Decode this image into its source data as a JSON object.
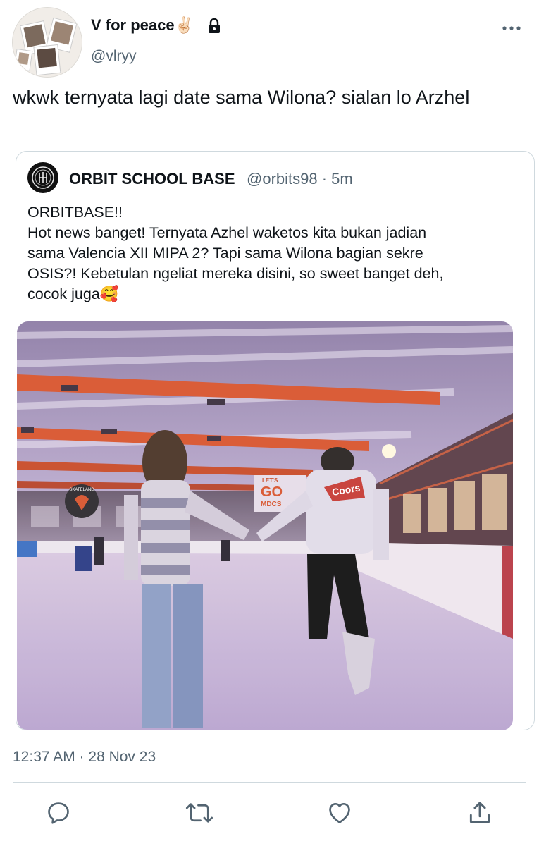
{
  "author": {
    "display_name": "V for peace✌🏻",
    "handle": "@vlryy"
  },
  "tweet": {
    "text": "wkwk ternyata lagi date sama Wilona? sialan lo Arzhel",
    "timestamp": "12:37 AM · 28 Nov 23"
  },
  "quote": {
    "display_name": "ORBIT SCHOOL BASE",
    "handle_time": "@orbits98 · 5m",
    "lines": [
      "ORBITBASE!!",
      "Hot news banget! Ternyata Azhel waketos kita bukan jadian",
      "sama Valencia XII MIPA 2? Tapi sama Wilona bagian sekre",
      "OSIS?! Kebetulan ngeliat mereka disini, so sweet banget deh,",
      "cocok juga🥰"
    ],
    "photo_signs": {
      "rink_sign_top": "LET'S",
      "rink_sign_main": "GO",
      "rink_sign_sub": "MDCS",
      "round_sign": "SKATELAND",
      "hoodie_logo": "Coors"
    }
  },
  "icons": {
    "lock": "lock-icon",
    "more": "more-icon",
    "reply": "reply-icon",
    "retweet": "retweet-icon",
    "like": "like-icon",
    "share": "share-icon"
  },
  "colors": {
    "text": "#0f1419",
    "secondary": "#536471",
    "border": "#cfd9de",
    "rink_beams": "#d8552e"
  }
}
